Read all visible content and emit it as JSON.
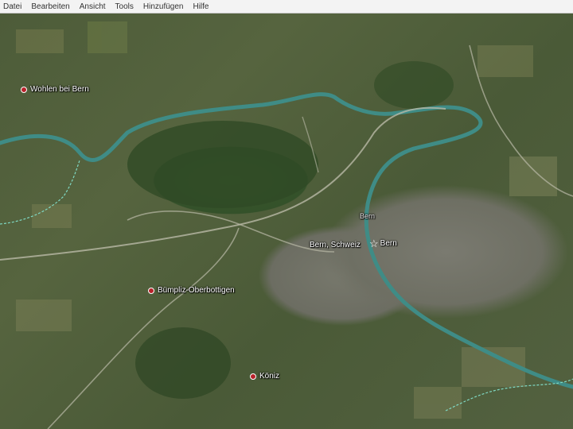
{
  "menu": {
    "items": [
      "Datei",
      "Bearbeiten",
      "Ansicht",
      "Tools",
      "Hinzufügen",
      "Hilfe"
    ]
  },
  "map": {
    "places": {
      "wohlen": "Wohlen bei Bern",
      "bern_region": "Bern",
      "bern_schweiz": "Bern, Schweiz",
      "bern_star": "Bern",
      "bumpliz": "Bümpliz-Oberbottigen",
      "koniz": "Köniz"
    },
    "icons": {
      "place_marker": "red-dot-icon",
      "capital_marker": "star-icon"
    },
    "colors": {
      "river": "#3f8c86",
      "border": "#7fd9c4",
      "marker": "#b8222a",
      "label": "#ffffff"
    }
  }
}
